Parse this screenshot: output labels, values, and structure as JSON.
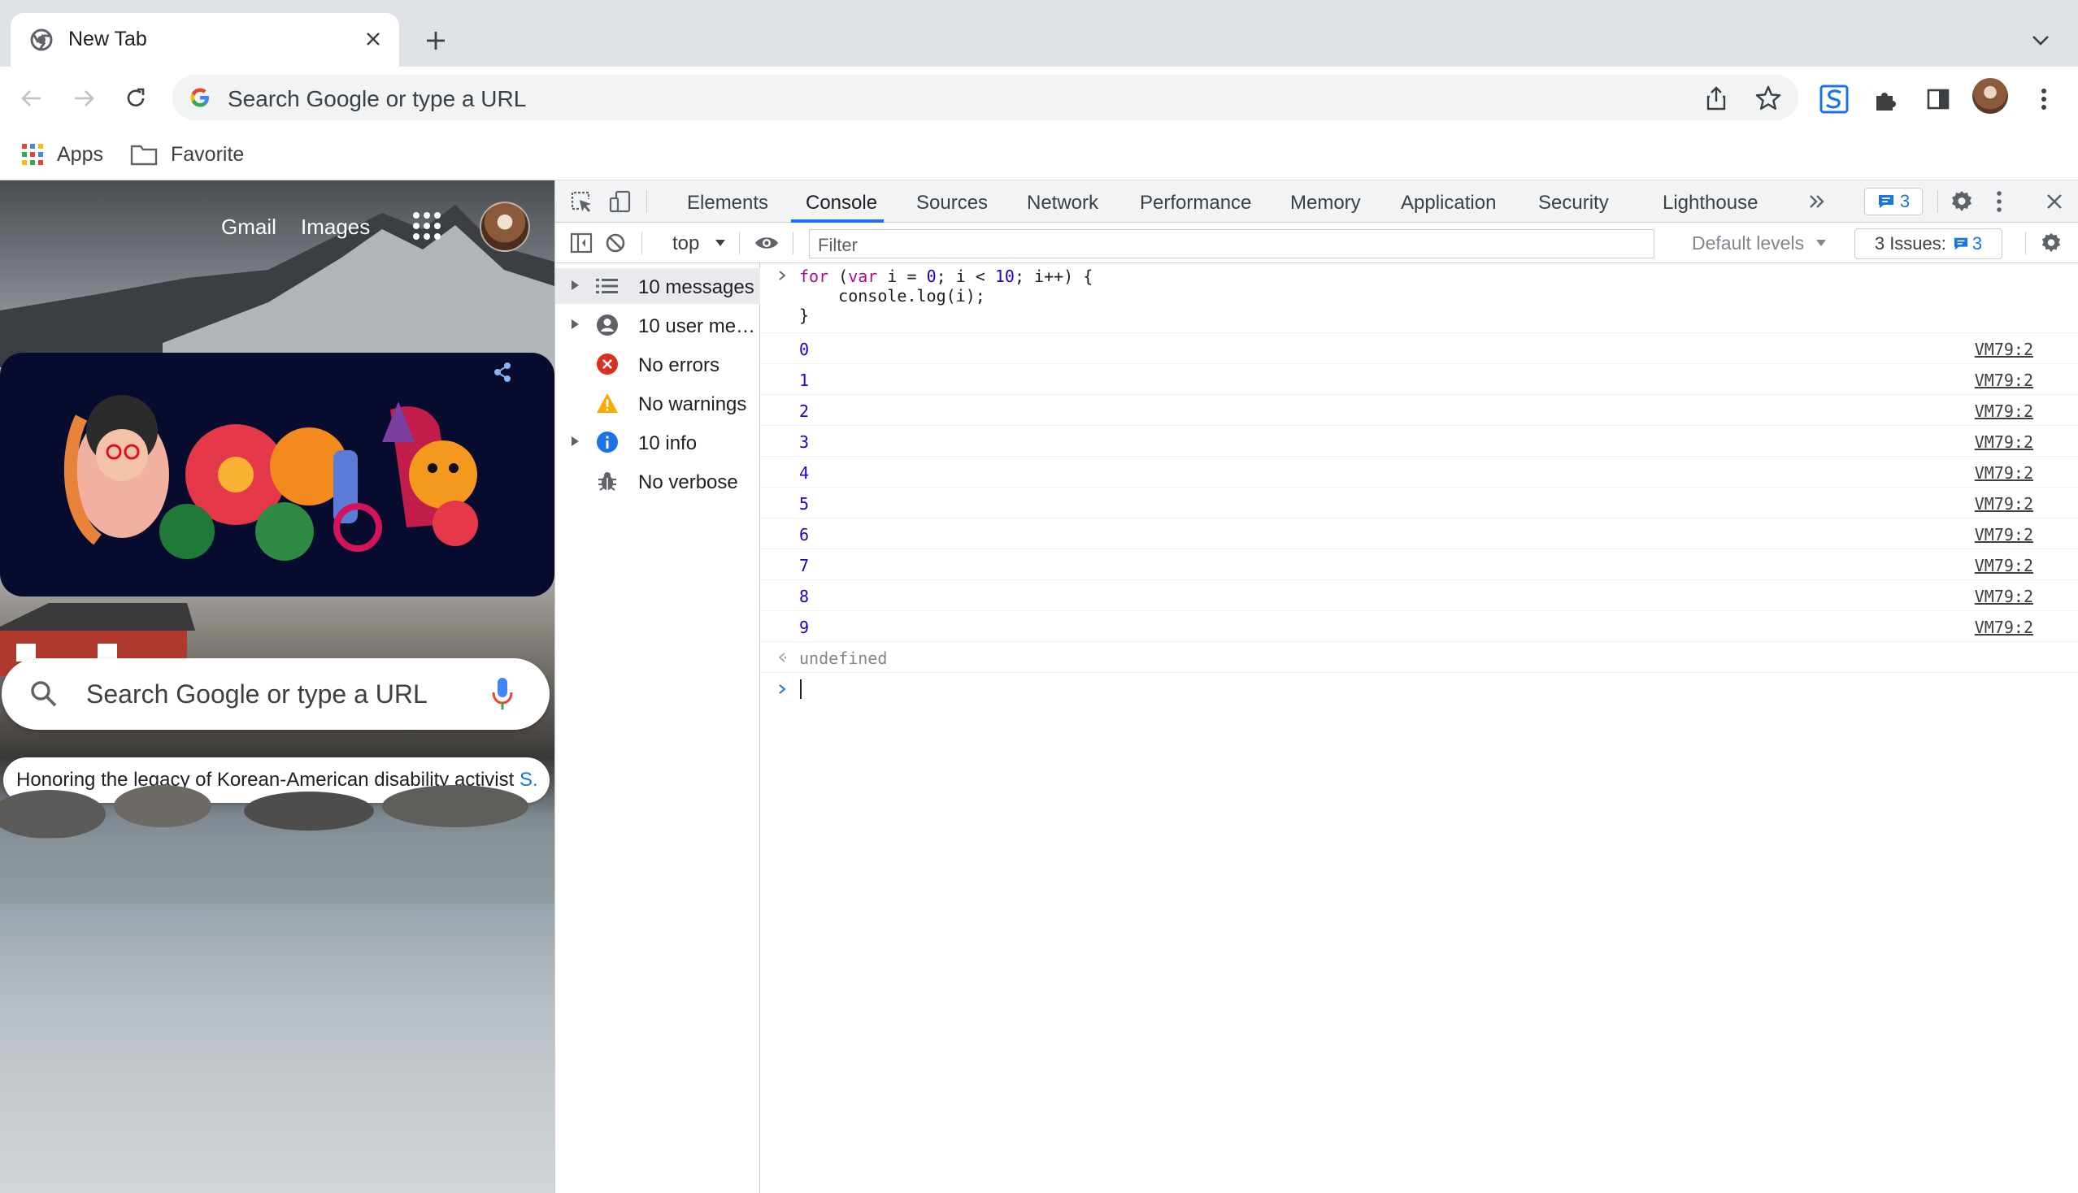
{
  "browser": {
    "tab_title": "New Tab",
    "omnibox_placeholder": "Search Google or type a URL",
    "bookmarks": [
      {
        "label": "Apps"
      },
      {
        "label": "Favorite"
      }
    ]
  },
  "ntp": {
    "links": [
      "Gmail",
      "Images"
    ],
    "search_placeholder": "Search Google or type a URL",
    "doodle_caption": "Honoring the legacy of Korean-American disability activist",
    "doodle_caption_link": "S."
  },
  "devtools": {
    "tabs": [
      "Elements",
      "Console",
      "Sources",
      "Network",
      "Performance",
      "Memory",
      "Application",
      "Security",
      "Lighthouse"
    ],
    "active_tab": "Console",
    "messages_badge": "3",
    "context": "top",
    "filter_placeholder": "Filter",
    "levels": "Default levels",
    "issues_label": "3 Issues:",
    "issues_count": "3",
    "sidebar": [
      {
        "label": "10 messages",
        "icon": "list-icon",
        "expandable": true
      },
      {
        "label": "10 user me…",
        "icon": "user-icon",
        "expandable": true
      },
      {
        "label": "No errors",
        "icon": "error-icon",
        "expandable": false
      },
      {
        "label": "No warnings",
        "icon": "warning-icon",
        "expandable": false
      },
      {
        "label": "10 info",
        "icon": "info-icon",
        "expandable": true
      },
      {
        "label": "No verbose",
        "icon": "bug-icon",
        "expandable": false
      }
    ],
    "console": {
      "code": [
        "for (var i = 0; i < 10; i++) {",
        "    console.log(i);",
        "}"
      ],
      "logs": [
        {
          "value": "0",
          "source": "VM79:2"
        },
        {
          "value": "1",
          "source": "VM79:2"
        },
        {
          "value": "2",
          "source": "VM79:2"
        },
        {
          "value": "3",
          "source": "VM79:2"
        },
        {
          "value": "4",
          "source": "VM79:2"
        },
        {
          "value": "5",
          "source": "VM79:2"
        },
        {
          "value": "6",
          "source": "VM79:2"
        },
        {
          "value": "7",
          "source": "VM79:2"
        },
        {
          "value": "8",
          "source": "VM79:2"
        },
        {
          "value": "9",
          "source": "VM79:2"
        }
      ],
      "result": "undefined"
    }
  },
  "colors": {
    "accent": "#1a73e8",
    "keyword": "#aa0d91",
    "number": "#1c00cf",
    "error": "#d93025",
    "warning": "#f9ab00"
  }
}
